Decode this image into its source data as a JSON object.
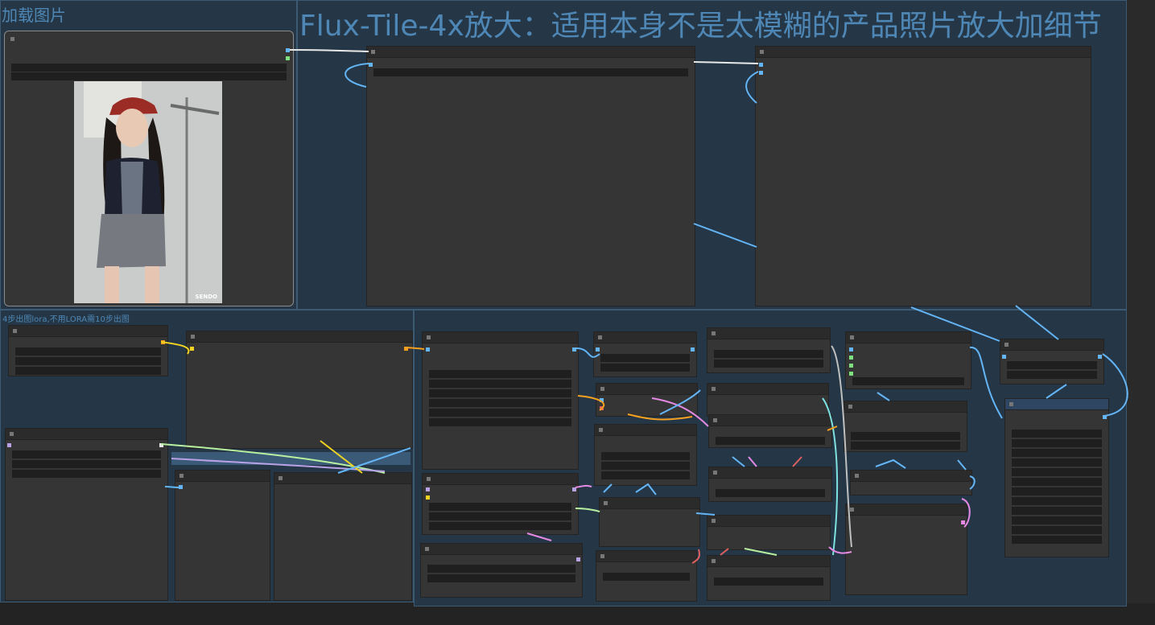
{
  "groups": {
    "load_image": {
      "title": "加载图片"
    },
    "upscale": {
      "title": "Flux-Tile-4x放大：适用本身不是太模糊的产品照片放大加细节"
    },
    "lora_note": {
      "title": "4步出图lora,不用LORA需10步出图"
    }
  },
  "image_preview": {
    "watermark": "SENDO"
  },
  "colors": {
    "canvas": "#232323",
    "group_bg": "#253746",
    "group_title": "#4e87b5",
    "node_bg": "#353535",
    "wire_blue": "#64b5f6",
    "wire_pink": "#e48ae4",
    "wire_yellow": "#f2d420",
    "wire_green": "#b8f0a0",
    "wire_purple": "#b9a1e6"
  }
}
